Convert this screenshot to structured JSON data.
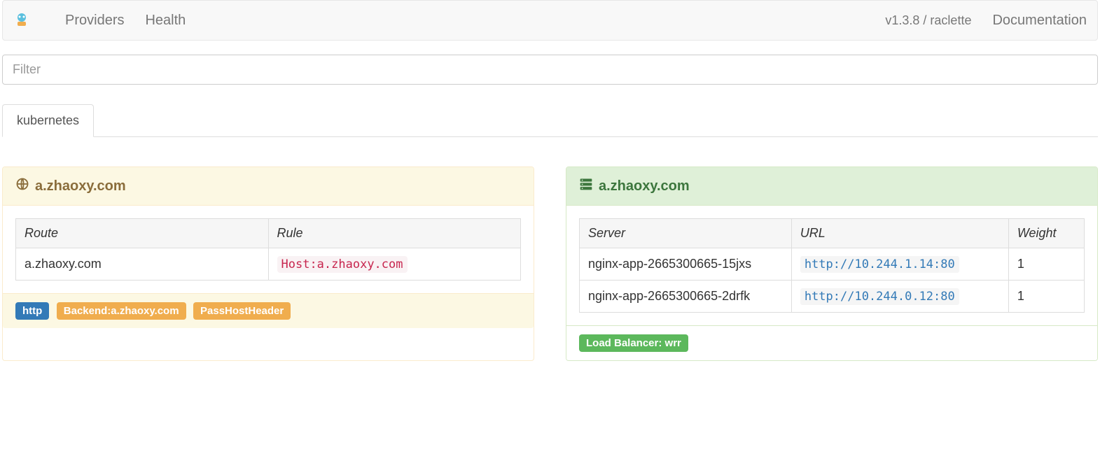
{
  "nav": {
    "providers": "Providers",
    "health": "Health",
    "version": "v1.3.8 / raclette",
    "documentation": "Documentation"
  },
  "filter": {
    "placeholder": "Filter"
  },
  "tabs": {
    "active": "kubernetes"
  },
  "frontend": {
    "title": "a.zhaoxy.com",
    "columns": {
      "route": "Route",
      "rule": "Rule"
    },
    "rows": [
      {
        "route": "a.zhaoxy.com",
        "rule": "Host:a.zhaoxy.com"
      }
    ],
    "badges": {
      "http": "http",
      "backend": "Backend:a.zhaoxy.com",
      "passHost": "PassHostHeader"
    }
  },
  "backend": {
    "title": "a.zhaoxy.com",
    "columns": {
      "server": "Server",
      "url": "URL",
      "weight": "Weight"
    },
    "rows": [
      {
        "server": "nginx-app-2665300665-15jxs",
        "url": "http://10.244.1.14:80",
        "weight": "1"
      },
      {
        "server": "nginx-app-2665300665-2drfk",
        "url": "http://10.244.0.12:80",
        "weight": "1"
      }
    ],
    "lb_badge": "Load Balancer: wrr"
  }
}
